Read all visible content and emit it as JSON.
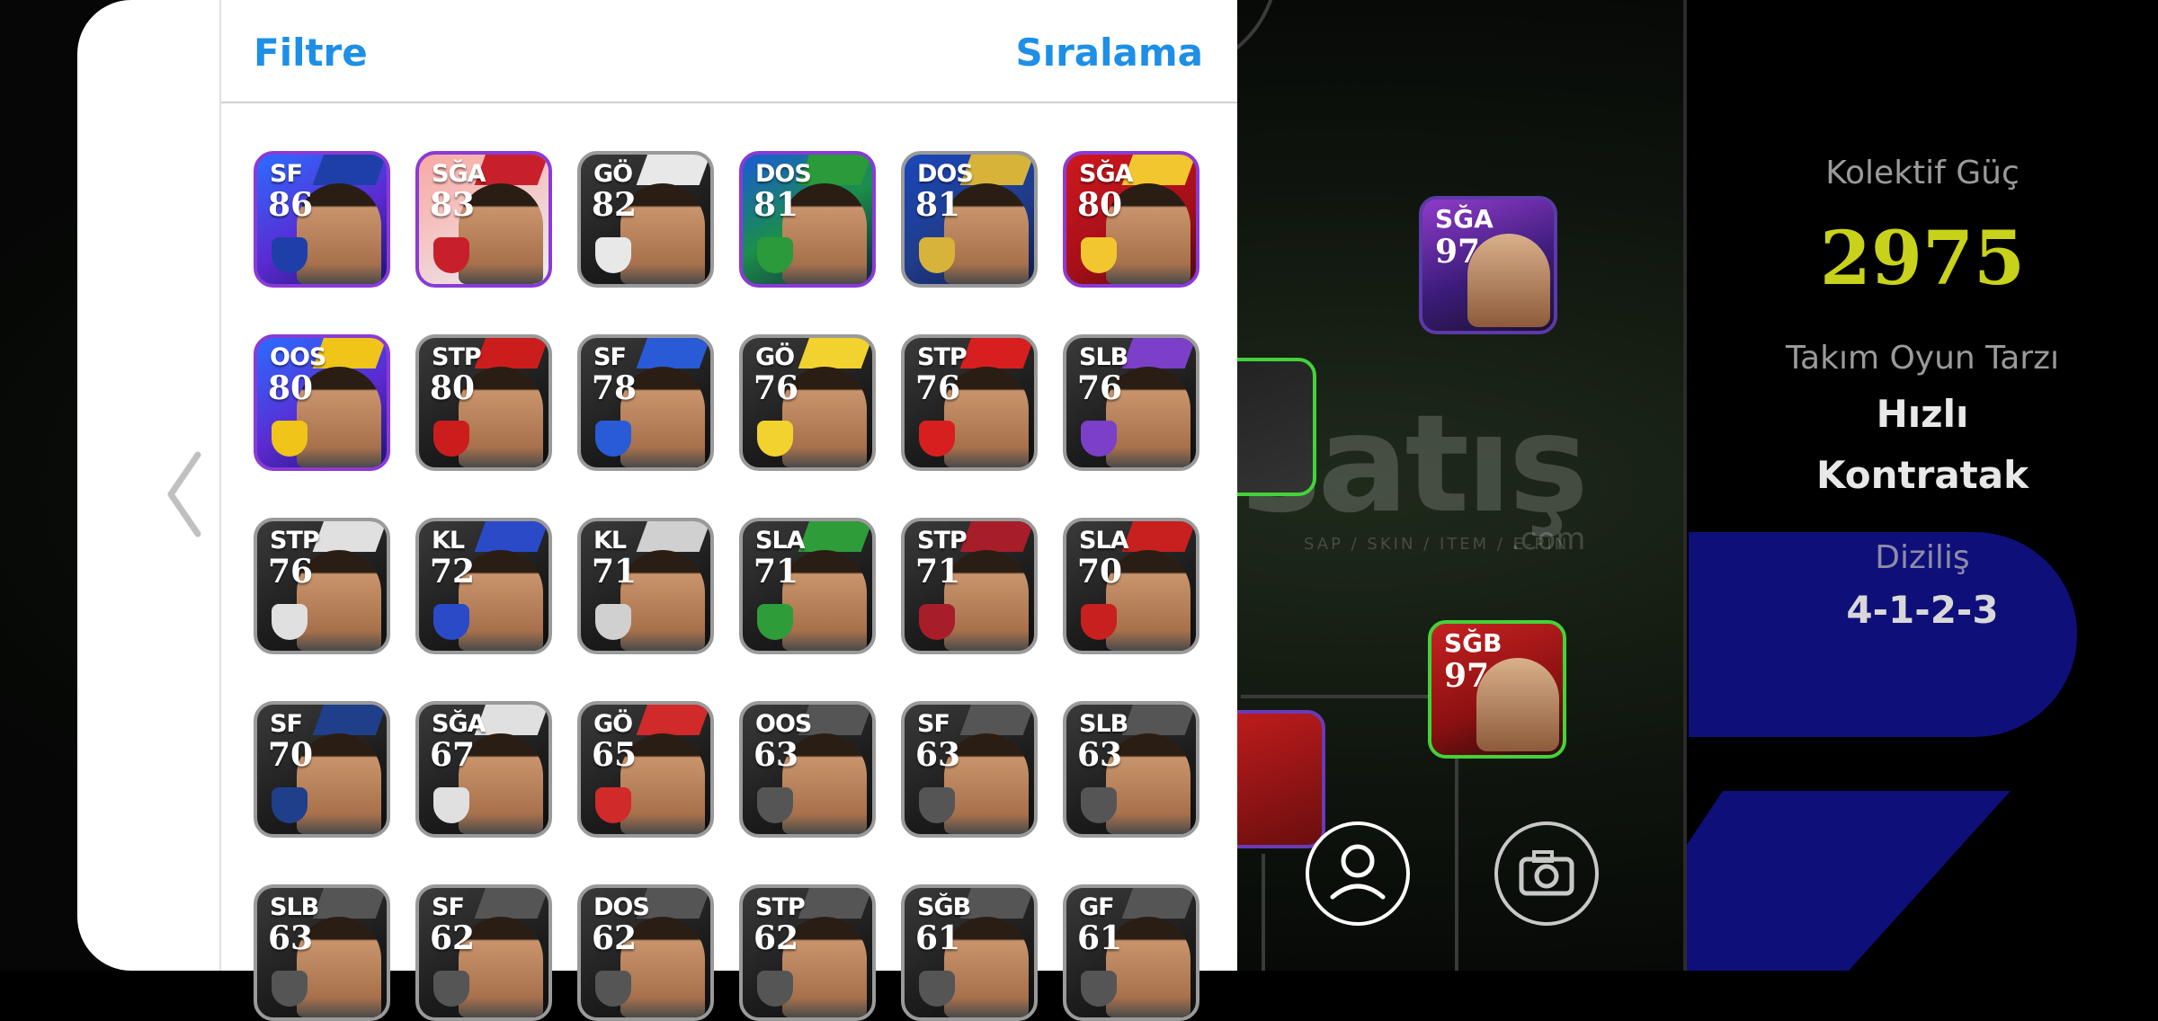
{
  "header": {
    "filter_label": "Filtre",
    "sort_label": "Sıralama"
  },
  "team_panel": {
    "power_label": "Kolektif Güç",
    "power_value": "2975",
    "style_label": "Takım Oyun Tarzı",
    "style_value_line1": "Hızlı",
    "style_value_line2": "Kontratak",
    "formation_label": "Diziliş",
    "formation_value": "4-1-2-3",
    "accent_color": "#c8d21a"
  },
  "watermark": {
    "main": "satış",
    "sub": "SAP / SKIN / ITEM / E-PIN",
    "com": ".com"
  },
  "pitch_cards": [
    {
      "pos": "SĞA",
      "rating": "97"
    },
    {
      "pos": "SĞB",
      "rating": "97"
    }
  ],
  "buttons": {
    "profile_icon": "person-icon",
    "camera_icon": "camera-icon",
    "back_icon": "chevron-left-icon"
  },
  "players": [
    {
      "pos": "SF",
      "rating": "86",
      "style": "blue-bg purple",
      "badge": "#1f3fa8"
    },
    {
      "pos": "SĞA",
      "rating": "83",
      "style": "pink-bg purple",
      "badge": "#c8202a"
    },
    {
      "pos": "GÖ",
      "rating": "82",
      "style": "",
      "badge": "#e8e8e8"
    },
    {
      "pos": "DOS",
      "rating": "81",
      "style": "green-bg purple",
      "badge": "#2a9a3a"
    },
    {
      "pos": "DOS",
      "rating": "81",
      "style": "navy-bg",
      "badge": "#d7b33a"
    },
    {
      "pos": "SĞA",
      "rating": "80",
      "style": "red-bg purple",
      "badge": "#f2c62e"
    },
    {
      "pos": "OOS",
      "rating": "80",
      "style": "blue-bg purple",
      "badge": "#f0c419"
    },
    {
      "pos": "STP",
      "rating": "80",
      "style": "",
      "badge": "#cc1d1d"
    },
    {
      "pos": "SF",
      "rating": "78",
      "style": "",
      "badge": "#2a5bd6"
    },
    {
      "pos": "GÖ",
      "rating": "76",
      "style": "",
      "badge": "#f2d22e"
    },
    {
      "pos": "STP",
      "rating": "76",
      "style": "",
      "badge": "#d81f1f"
    },
    {
      "pos": "SLB",
      "rating": "76",
      "style": "",
      "badge": "#7b3fc8"
    },
    {
      "pos": "STP",
      "rating": "76",
      "style": "",
      "badge": "#e0e0e0"
    },
    {
      "pos": "KL",
      "rating": "72",
      "style": "",
      "badge": "#2a4ac8"
    },
    {
      "pos": "KL",
      "rating": "71",
      "style": "",
      "badge": "#d0d0d0"
    },
    {
      "pos": "SLA",
      "rating": "71",
      "style": "",
      "badge": "#2f9c3a"
    },
    {
      "pos": "STP",
      "rating": "71",
      "style": "",
      "badge": "#a81d2a"
    },
    {
      "pos": "SLA",
      "rating": "70",
      "style": "",
      "badge": "#c81f1f"
    },
    {
      "pos": "SF",
      "rating": "70",
      "style": "",
      "badge": "#1f3f8a"
    },
    {
      "pos": "SĞA",
      "rating": "67",
      "style": "",
      "badge": "#e0e0e0"
    },
    {
      "pos": "GÖ",
      "rating": "65",
      "style": "",
      "badge": "#d02a2a"
    },
    {
      "pos": "OOS",
      "rating": "63",
      "style": "",
      "badge": "#555555"
    },
    {
      "pos": "SF",
      "rating": "63",
      "style": "",
      "badge": "#555555"
    },
    {
      "pos": "SLB",
      "rating": "63",
      "style": "",
      "badge": "#555555"
    },
    {
      "pos": "SLB",
      "rating": "63",
      "style": "",
      "badge": "#555555"
    },
    {
      "pos": "SF",
      "rating": "62",
      "style": "",
      "badge": "#555555"
    },
    {
      "pos": "DOS",
      "rating": "62",
      "style": "",
      "badge": "#555555"
    },
    {
      "pos": "STP",
      "rating": "62",
      "style": "",
      "badge": "#555555"
    },
    {
      "pos": "SĞB",
      "rating": "61",
      "style": "",
      "badge": "#555555"
    },
    {
      "pos": "GF",
      "rating": "61",
      "style": "",
      "badge": "#555555"
    }
  ]
}
